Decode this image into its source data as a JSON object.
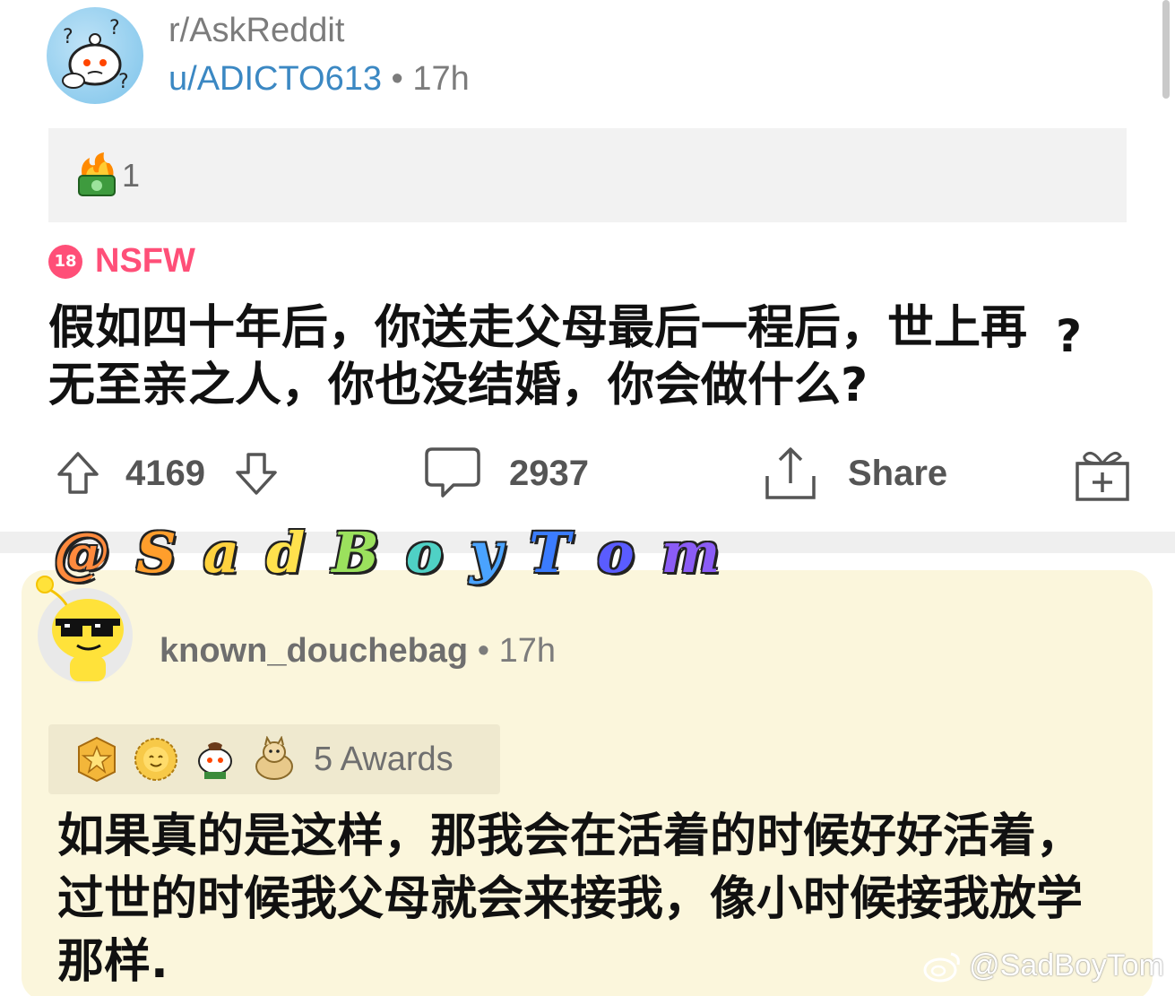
{
  "post": {
    "subreddit": "r/AskReddit",
    "author": "u/ADICTO613",
    "separator": "•",
    "time": "17h",
    "award_count": "1",
    "nsfw_badge": "18",
    "nsfw_label": "NSFW",
    "title": "假如四十年后，你送走父母最后一程后，世上再无至亲之人，你也没结婚，你会做什么?",
    "stray_mark": "?",
    "upvotes": "4169",
    "comments": "2937",
    "share_label": "Share"
  },
  "handle": [
    "@",
    "S",
    "a",
    "d",
    "B",
    "o",
    "y",
    "T",
    "o",
    "m"
  ],
  "handle_colors": [
    "#ff8a3d",
    "#ff9e2c",
    "#ffd23f",
    "#ffe14d",
    "#9be15d",
    "#4fd1c5",
    "#4aa3ff",
    "#3b7cff",
    "#5a5cff",
    "#8b5cf6"
  ],
  "comment": {
    "username": "known_douchebag",
    "separator": "•",
    "time": "17h",
    "awards_label": "5 Awards",
    "body": "如果真的是这样，那我会在活着的时候好好活着，过世的时候我父母就会来接我，像小时候接我放学那样."
  },
  "watermark": "@SadBoyTom",
  "colors": {
    "username_blue": "#3b88c3",
    "nsfw_pink": "#ff4f78",
    "comment_bg": "#fbf6dc"
  },
  "icons": [
    "snoo-avatar-icon",
    "money-fire-award-icon",
    "upvote-icon",
    "downvote-icon",
    "comment-icon",
    "share-icon",
    "gift-icon",
    "star-award-icon",
    "sun-award-icon",
    "snoo-award-icon",
    "doge-award-icon",
    "weibo-logo-icon"
  ]
}
